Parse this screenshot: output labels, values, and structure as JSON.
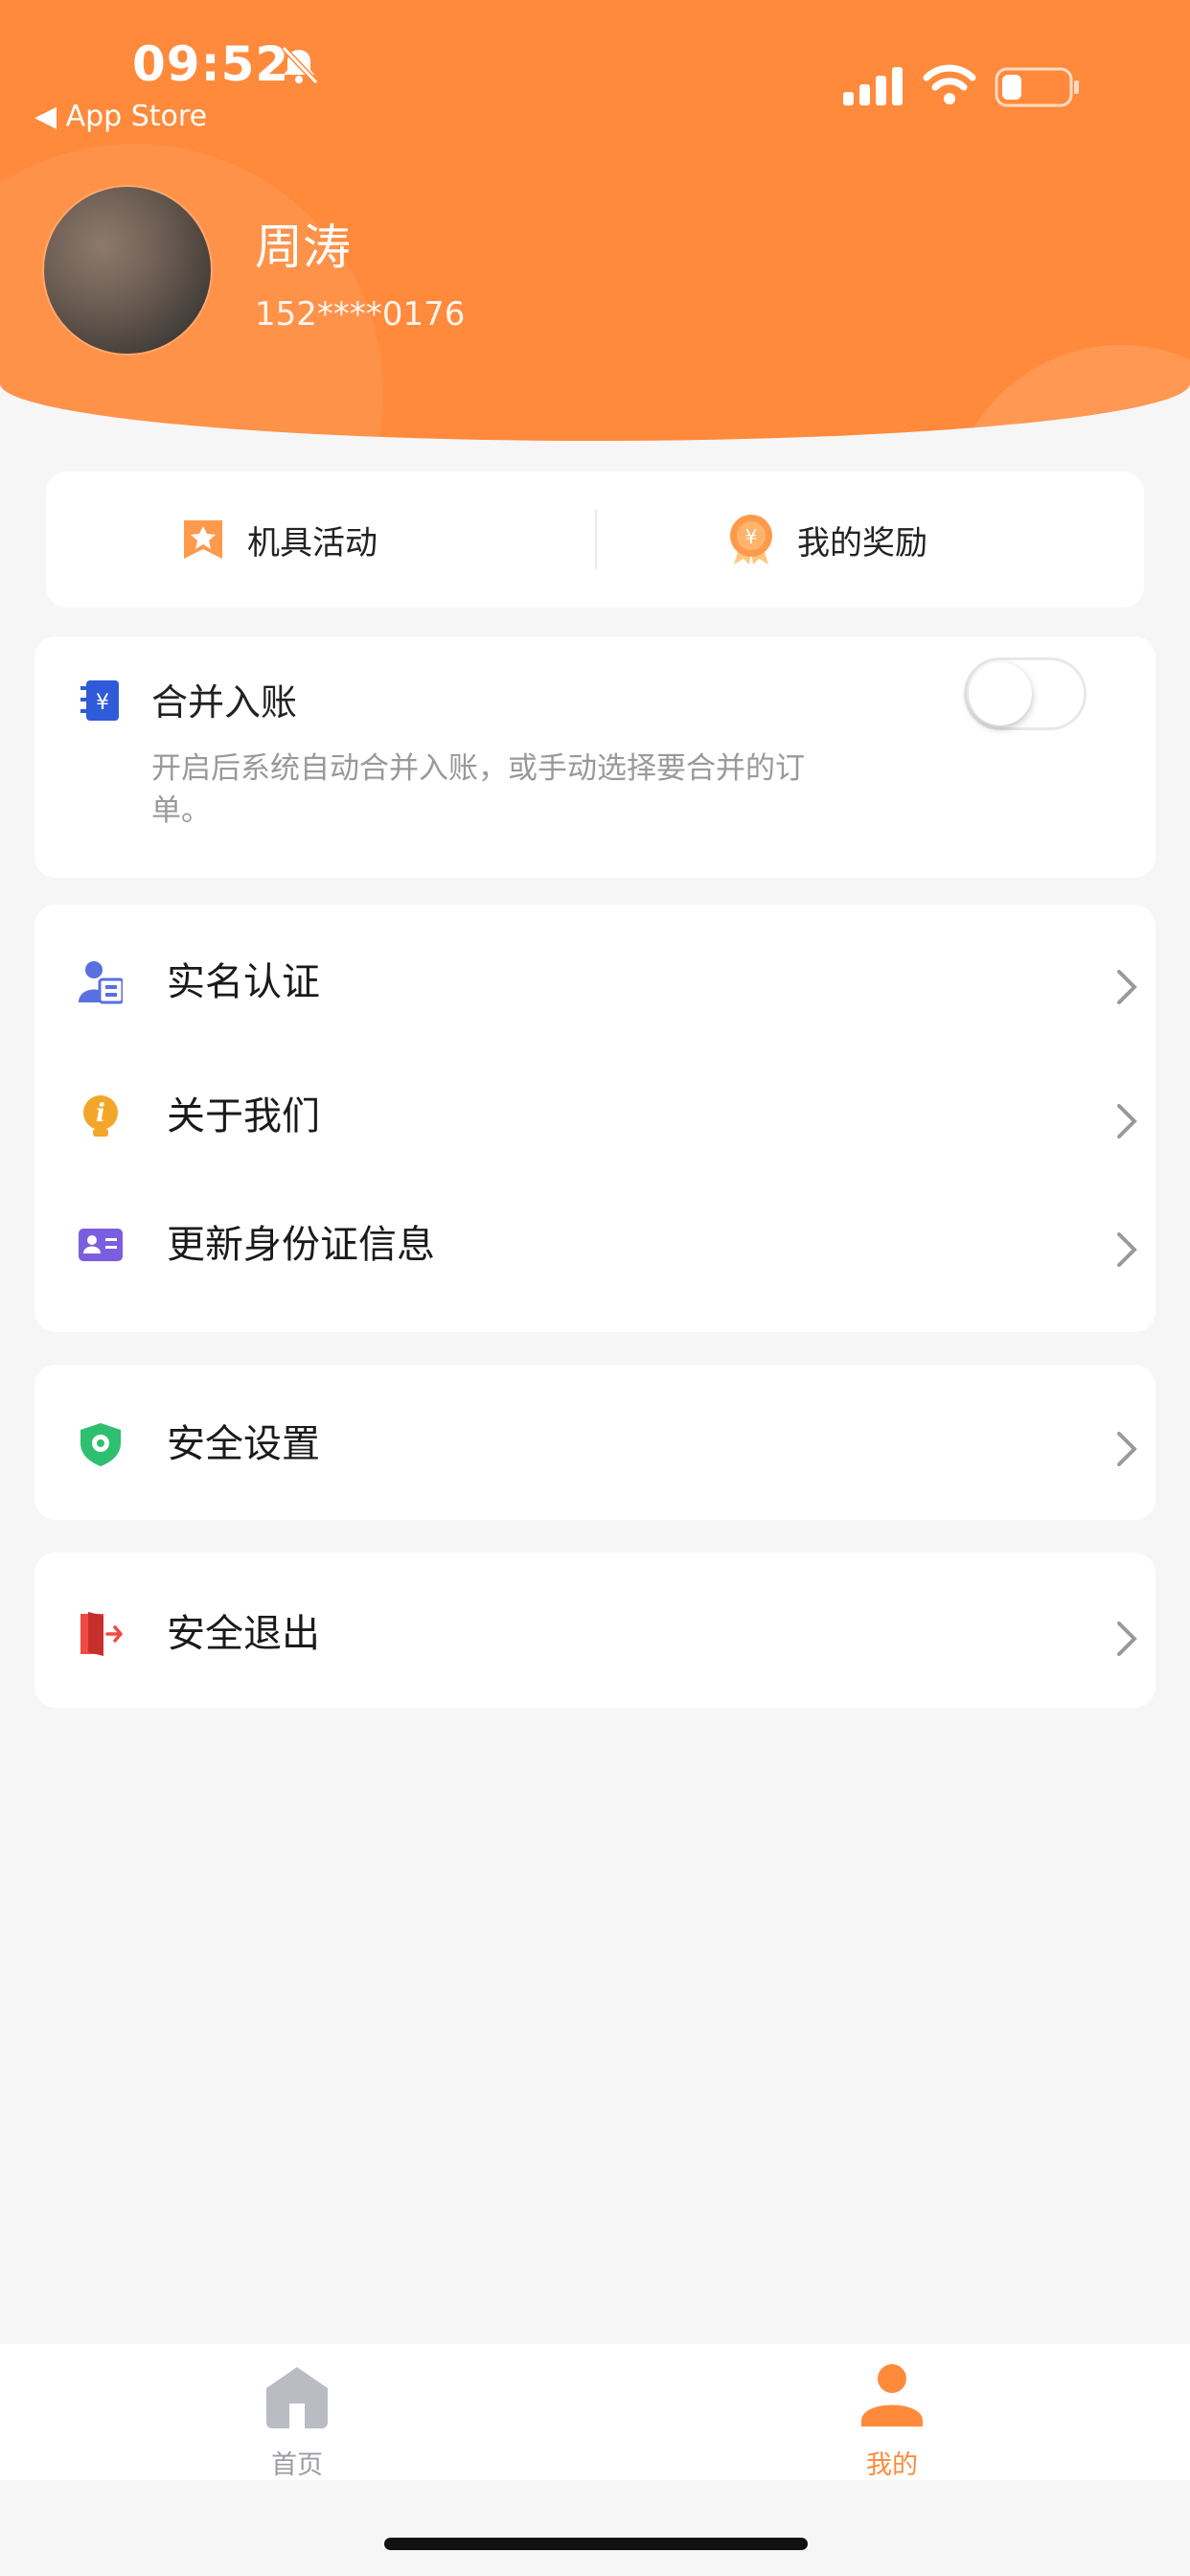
{
  "status_bar": {
    "time": "09:52",
    "back_label": "◀ App Store"
  },
  "profile": {
    "name": "周涛",
    "phone": "152****0176"
  },
  "quick_actions": [
    {
      "label": "机具活动",
      "icon": "star-flag-icon"
    },
    {
      "label": "我的奖励",
      "icon": "reward-medal-icon"
    }
  ],
  "merge_account": {
    "title": "合并入账",
    "description": "开启后系统自动合并入账，或手动选择要合并的订单。",
    "enabled": false
  },
  "menu_group_1": [
    {
      "label": "实名认证",
      "icon": "user-id-icon"
    },
    {
      "label": "关于我们",
      "icon": "info-bulb-icon"
    },
    {
      "label": "更新身份证信息",
      "icon": "id-card-icon"
    }
  ],
  "menu_group_2": [
    {
      "label": "安全设置",
      "icon": "shield-gear-icon"
    }
  ],
  "menu_group_3": [
    {
      "label": "安全退出",
      "icon": "exit-door-icon"
    }
  ],
  "tabbar": {
    "home_label": "首页",
    "mine_label": "我的"
  },
  "colors": {
    "accent": "#ff8a3c",
    "background": "#f6f6f7"
  }
}
